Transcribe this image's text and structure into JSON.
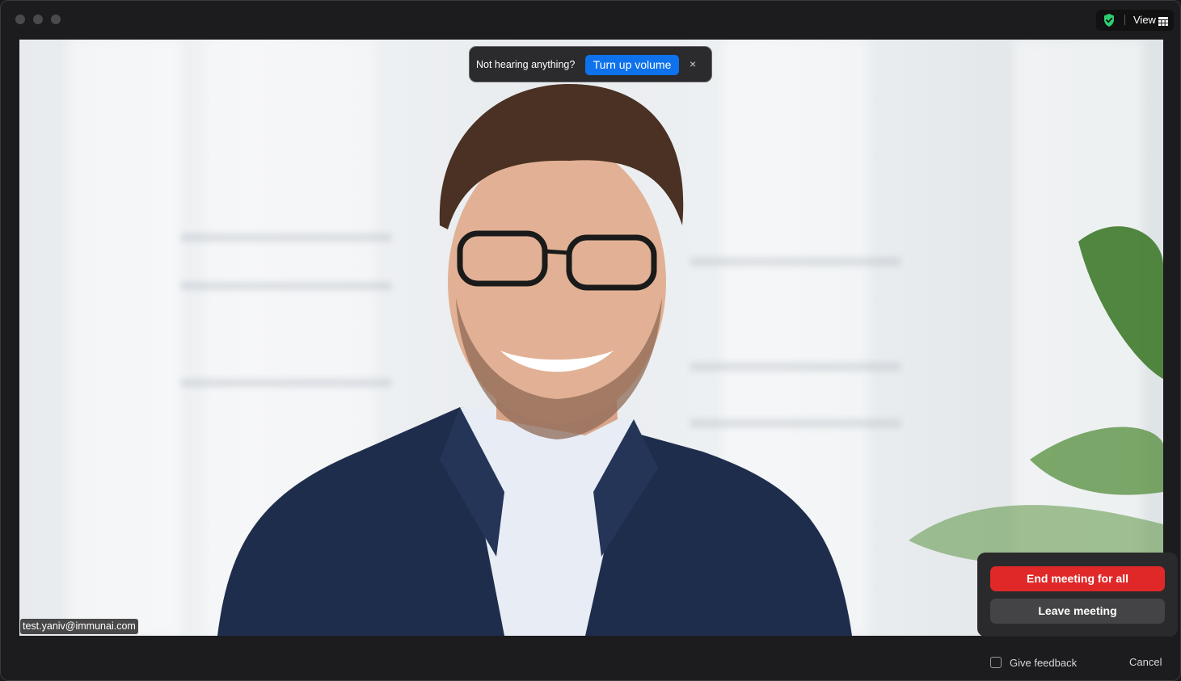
{
  "header": {
    "view_label": "View",
    "shield_icon": "shield-check-icon",
    "view_icon": "grid-view-icon",
    "shield_color": "#2ecc71"
  },
  "audio_banner": {
    "message": "Not hearing anything?",
    "button_label": "Turn up volume",
    "close_glyph": "×",
    "button_color": "#0e72ed"
  },
  "video": {
    "participant_name": "test.yaniv@immunai.com"
  },
  "end_menu": {
    "end_all_label": "End meeting for all",
    "leave_label": "Leave meeting",
    "end_color": "#e02828"
  },
  "footer": {
    "feedback_label": "Give feedback",
    "feedback_checked": false,
    "cancel_label": "Cancel"
  }
}
